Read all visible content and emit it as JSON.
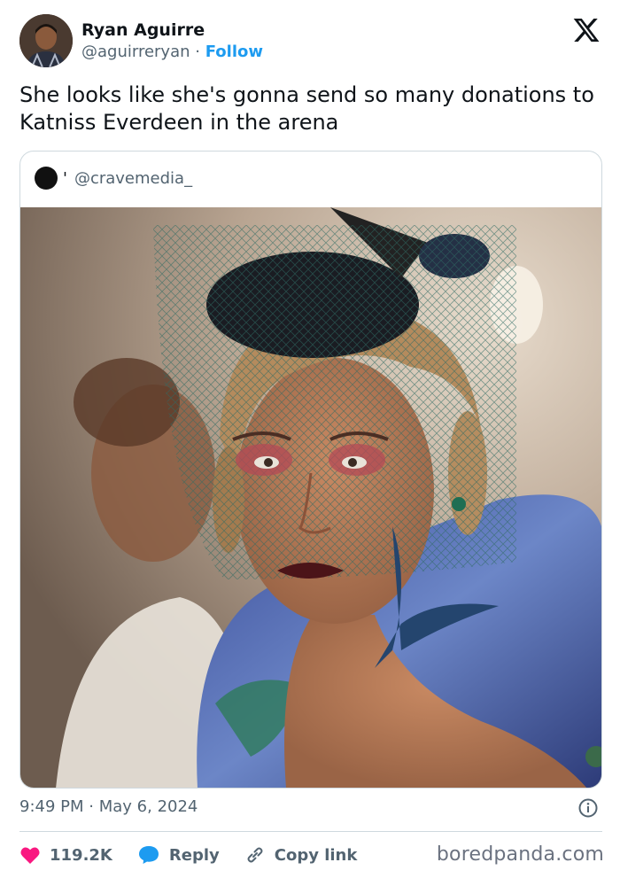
{
  "author": {
    "display_name": "Ryan Aguirre",
    "handle": "@aguirreryan",
    "separator": "·",
    "follow_label": "Follow"
  },
  "tweet": {
    "text": "She looks like she's gonna send so many donations to Katniss Everdeen in the arena"
  },
  "quote": {
    "handle": "@cravemedia_",
    "mark": "'"
  },
  "meta": {
    "time": "9:49 PM",
    "separator": "·",
    "date": "May 6, 2024"
  },
  "actions": {
    "likes": "119.2K",
    "reply_label": "Reply",
    "copy_label": "Copy link"
  },
  "watermark": "boredpanda.com",
  "colors": {
    "like": "#f91880",
    "reply": "#1d9bf0",
    "follow": "#1d9bf0",
    "text": "#0f1419",
    "muted": "#536471"
  },
  "icons": {
    "brand": "x-logo-icon",
    "like": "heart-icon",
    "reply": "speech-bubble-icon",
    "copy": "link-icon",
    "info": "info-icon"
  }
}
